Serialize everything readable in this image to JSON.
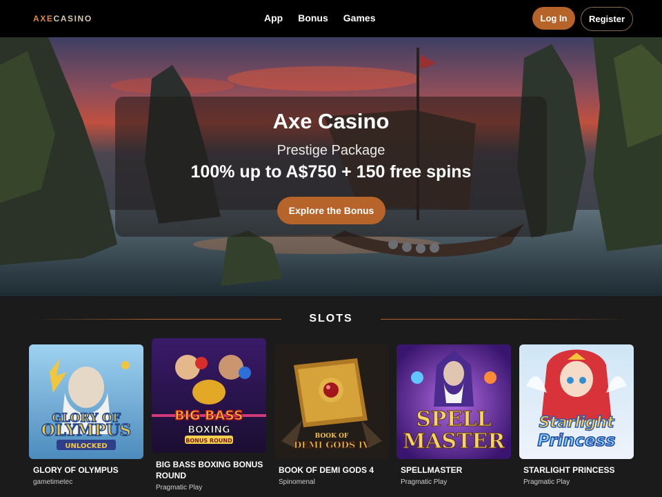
{
  "header": {
    "logo_accent": "AXE",
    "logo_rest": "CASINO",
    "nav": [
      "App",
      "Bonus",
      "Games"
    ],
    "login_label": "Log In",
    "register_label": "Register"
  },
  "hero": {
    "title": "Axe Casino",
    "subtitle": "Prestige Package",
    "offer": "100% up to A$750 + 150 free spins",
    "cta_label": "Explore the Bonus"
  },
  "slots": {
    "heading": "SLOTS",
    "games": [
      {
        "name": "GLORY OF OLYMPUS",
        "provider": "gametimetec",
        "art_text_1": "GLORY OF",
        "art_text_2": "OLYMPUS",
        "art_text_3": "UNLOCKED"
      },
      {
        "name": "BIG BASS BOXING BONUS ROUND",
        "provider": "Pragmatic Play",
        "art_text_1": "BIG BASS",
        "art_text_2": "BOXING",
        "art_text_3": "BONUS ROUND"
      },
      {
        "name": "BOOK OF DEMI GODS 4",
        "provider": "Spinomenal",
        "art_text_1": "BOOK OF",
        "art_text_2": "DEMI GODS IV"
      },
      {
        "name": "SPELLMASTER",
        "provider": "Pragmatic Play",
        "art_text_1": "SPELL",
        "art_text_2": "MASTER"
      },
      {
        "name": "STARLIGHT PRINCESS",
        "provider": "Pragmatic Play",
        "art_text_1": "Starlight",
        "art_text_2": "Princess"
      }
    ]
  },
  "colors": {
    "accent": "#b7642a",
    "logo_accent": "#e08a3c",
    "background": "#1b1b1b",
    "header": "#000000"
  }
}
